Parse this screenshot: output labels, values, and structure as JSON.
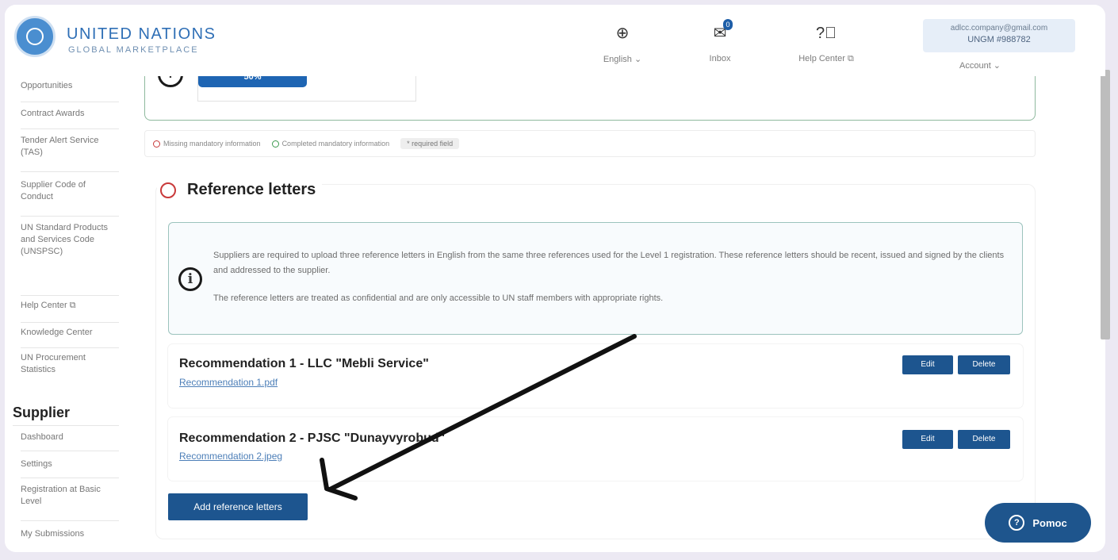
{
  "header": {
    "logo_title": "UNITED NATIONS",
    "logo_subtitle": "GLOBAL MARKETPLACE",
    "language_label": "English ⌄",
    "inbox_label": "Inbox",
    "inbox_count": "0",
    "help_label": "Help Center ⧉",
    "account_email": "adlcc.company@gmail.com",
    "account_id": "UNGM #988782",
    "account_label": "Account ⌄",
    "icons": [
      "globe-icon",
      "inbox-icon",
      "help-icon"
    ]
  },
  "sidebar": {
    "items_top": [
      {
        "label": "Procurement Opportunities"
      },
      {
        "label": "Contract Awards"
      },
      {
        "label": "Tender Alert Service (TAS)"
      },
      {
        "label": "Supplier Code of Conduct"
      },
      {
        "label": "UN Standard Products and Services Code (UNSPSC)"
      },
      {
        "label": "Help Center ⧉"
      },
      {
        "label": "Knowledge Center"
      },
      {
        "label": "UN Procurement Statistics"
      }
    ],
    "section_heading": "Supplier",
    "items_supplier": [
      {
        "label": "Dashboard"
      },
      {
        "label": "Settings"
      },
      {
        "label": "Registration at Basic Level"
      },
      {
        "label": "My Submissions"
      }
    ]
  },
  "progress": {
    "value": 0.5,
    "label": "50%"
  },
  "legend": {
    "missing": "Missing mandatory information",
    "completed": "Completed mandatory information",
    "required": "* required field"
  },
  "section": {
    "title": "Reference letters",
    "info_paragraph1": "Suppliers are required to upload three reference letters in English from the same three references used for the Level 1 registration. These reference letters should be recent, issued and signed by the clients and addressed to the supplier.",
    "info_paragraph2": "The reference letters are treated as confidential and are only accessible to UN staff members with appropriate rights."
  },
  "recommendations": [
    {
      "title": "Recommendation 1 - LLC \"Mebli Service\"",
      "file": "Recommendation 1.pdf",
      "edit_label": "Edit",
      "delete_label": "Delete"
    },
    {
      "title": "Recommendation 2 - PJSC \"Dunayvyrobud\"",
      "file": "Recommendation 2.jpeg",
      "edit_label": "Edit",
      "delete_label": "Delete"
    }
  ],
  "add_button_label": "Add reference letters",
  "help_widget_label": "Pomoc",
  "colors": {
    "primary": "#1d558f",
    "brand_blue": "#2f6fb6",
    "missing_red": "#c9393a",
    "completed_green": "#3d9a4f",
    "annotation_arrow": "#111111"
  }
}
